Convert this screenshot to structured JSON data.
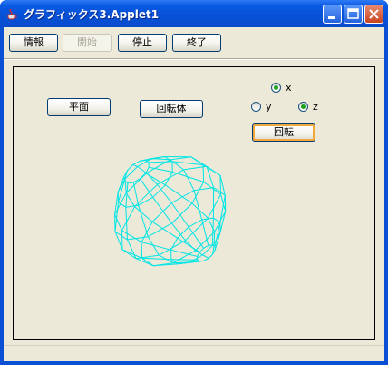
{
  "window": {
    "title": "グラフィックス3.Applet1",
    "controls": {
      "minimize_icon": "minimize-icon",
      "maximize_icon": "maximize-icon",
      "close_icon": "close-icon"
    }
  },
  "toolbar": {
    "info_label": "情報",
    "start_label": "開始",
    "stop_label": "停止",
    "exit_label": "終了"
  },
  "panel": {
    "plane_label": "平面",
    "solid_label": "回転体",
    "rotate_label": "回転",
    "axes": [
      {
        "label": "x",
        "checked": true
      },
      {
        "label": "y",
        "checked": false
      },
      {
        "label": "z",
        "checked": true
      }
    ]
  },
  "colors": {
    "wireframe": "#00e5e5",
    "titlebar": "#0a5ae3",
    "background": "#ece9d8"
  }
}
